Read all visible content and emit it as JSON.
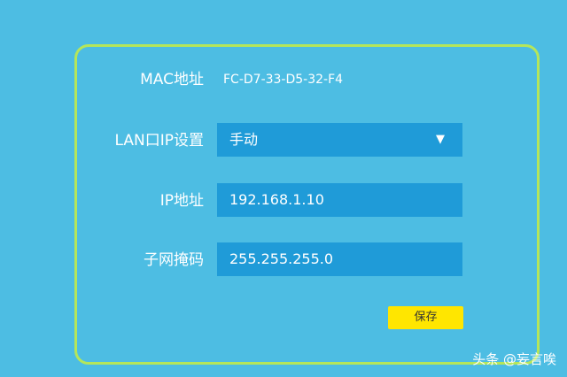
{
  "form": {
    "mac_label": "MAC地址",
    "mac_value": "FC-D7-33-D5-32-F4",
    "lan_label": "LAN口IP设置",
    "lan_mode": "手动",
    "ip_label": "IP地址",
    "ip_value": "192.168.1.10",
    "mask_label": "子网掩码",
    "mask_value": "255.255.255.0",
    "save_label": "保存"
  },
  "watermark": "头条 @妄言唉",
  "icons": {
    "dropdown": "chevron-down-icon"
  },
  "colors": {
    "background": "#4dbde3",
    "frame": "#b5e65a",
    "field": "#1f9bd8",
    "save_button": "#ffe600"
  }
}
